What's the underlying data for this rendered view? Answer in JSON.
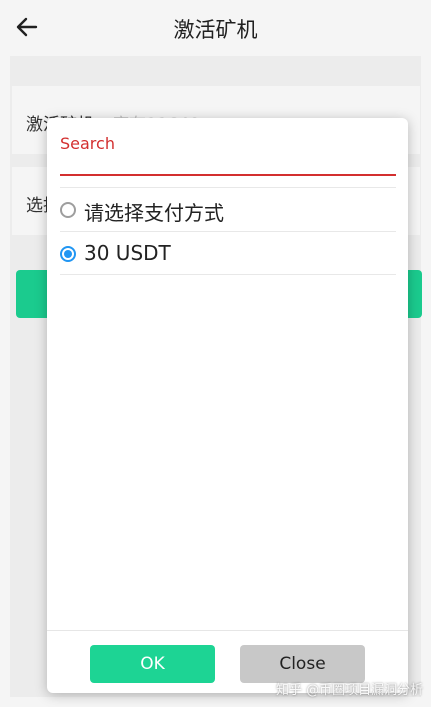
{
  "header": {
    "title": "激活矿机"
  },
  "cards": [
    {
      "label": "激活矿机",
      "value": "库存11640"
    },
    {
      "label": "选择"
    }
  ],
  "dialog": {
    "search": {
      "label": "Search",
      "value": ""
    },
    "options": [
      {
        "label": "请选择支付方式",
        "selected": false
      },
      {
        "label": "30 USDT",
        "selected": true
      }
    ],
    "ok_label": "OK",
    "close_label": "Close"
  },
  "watermark": {
    "text": "知乎 @币圈项目漏洞分析"
  },
  "colors": {
    "accent_green": "#1dd494",
    "accent_red": "#d32f2f",
    "radio_blue": "#2196f3"
  },
  "icons": {
    "back": "arrow-left-icon"
  }
}
